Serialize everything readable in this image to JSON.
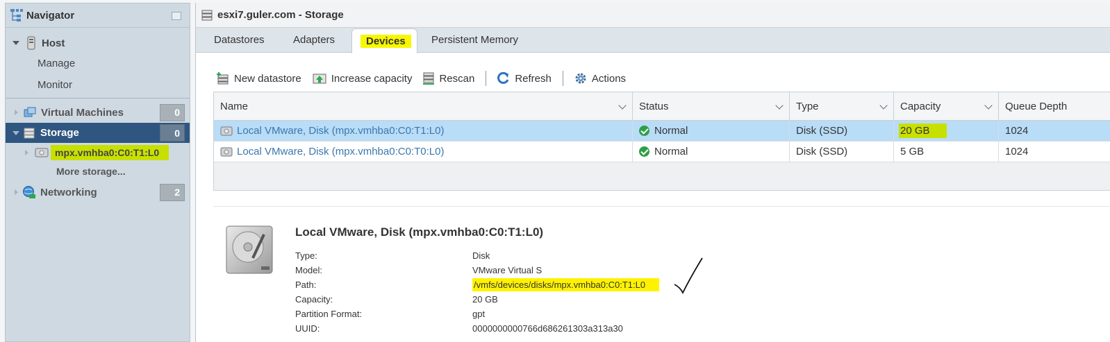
{
  "navigator": {
    "title": "Navigator",
    "host_label": "Host",
    "manage_label": "Manage",
    "monitor_label": "Monitor",
    "vms_label": "Virtual Machines",
    "vms_count": "0",
    "storage_label": "Storage",
    "storage_count": "0",
    "device_label": "mpx.vmhba0:C0:T1:L0",
    "more_storage_label": "More storage...",
    "networking_label": "Networking",
    "networking_count": "2"
  },
  "window": {
    "title": "esxi7.guler.com - Storage"
  },
  "tabs": [
    {
      "label": "Datastores"
    },
    {
      "label": "Adapters"
    },
    {
      "label": "Devices"
    },
    {
      "label": "Persistent Memory"
    }
  ],
  "toolbar": {
    "new_datastore": "New datastore",
    "increase_capacity": "Increase capacity",
    "rescan": "Rescan",
    "refresh": "Refresh",
    "actions": "Actions"
  },
  "table": {
    "columns": [
      "Name",
      "Status",
      "Type",
      "Capacity",
      "Queue Depth"
    ],
    "rows": [
      {
        "name": "Local VMware, Disk (mpx.vmhba0:C0:T1:L0)",
        "status": "Normal",
        "type": "Disk (SSD)",
        "capacity": "20 GB",
        "queue_depth": "1024"
      },
      {
        "name": "Local VMware, Disk (mpx.vmhba0:C0:T0:L0)",
        "status": "Normal",
        "type": "Disk (SSD)",
        "capacity": "5 GB",
        "queue_depth": "1024"
      }
    ]
  },
  "details": {
    "title": "Local VMware, Disk (mpx.vmhba0:C0:T1:L0)",
    "fields": [
      {
        "key": "Type:",
        "value": "Disk"
      },
      {
        "key": "Model:",
        "value": "VMware Virtual S"
      },
      {
        "key": "Path:",
        "value": "/vmfs/devices/disks/mpx.vmhba0:C0:T1:L0"
      },
      {
        "key": "Capacity:",
        "value": "20 GB"
      },
      {
        "key": "Partition Format:",
        "value": "gpt"
      },
      {
        "key": "UUID:",
        "value": "0000000000766d686261303a313a30"
      }
    ]
  },
  "colors": {
    "highlight_yellow": "#f7f700",
    "selected_row": "#b9dcf7",
    "storage_active": "#2f5680",
    "capacity_highlight": "#c8e000"
  }
}
